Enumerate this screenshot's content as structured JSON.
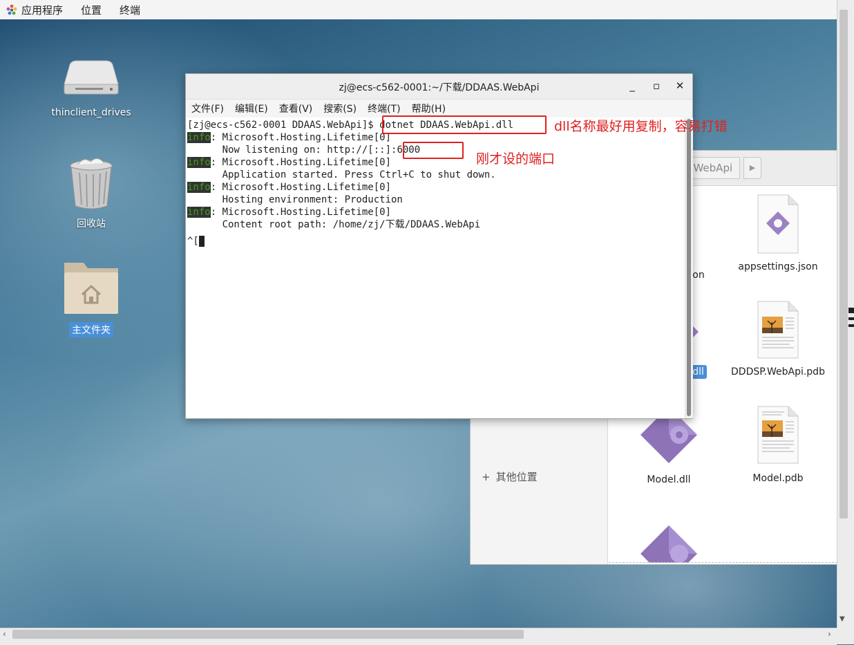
{
  "topbar": {
    "applications": "应用程序",
    "places": "位置",
    "terminal": "终端"
  },
  "desktop_icons": [
    {
      "label": "thinclient_drives"
    },
    {
      "label": "回收站"
    },
    {
      "label": "主文件夹"
    }
  ],
  "file_manager": {
    "breadcrumb": "P.WebApi",
    "sidebar_other": "其他位置",
    "partial_label_1": ".",
    "partial_label_2": "son",
    "files": [
      {
        "label": "appsettings.json"
      },
      {
        "label": "pi.dll"
      },
      {
        "label": "DDDSP.WebApi.pdb"
      },
      {
        "label": "Model.dll"
      },
      {
        "label": "Model.pdb"
      }
    ]
  },
  "terminal": {
    "title": "zj@ecs-c562-0001:~/下载/DDAAS.WebApi",
    "menu": [
      "文件(F)",
      "编辑(E)",
      "查看(V)",
      "搜索(S)",
      "终端(T)",
      "帮助(H)"
    ],
    "prompt": "[zj@ecs-c562-0001 DDAAS.WebApi]$ ",
    "command": "dotnet DDAAS.WebApi.dll",
    "info_tag": "info",
    "lines": [
      ": Microsoft.Hosting.Lifetime[0]",
      "      Now listening on: http://[::]:",
      ": Microsoft.Hosting.Lifetime[0]",
      "      Application started. Press Ctrl+C to shut down.",
      ": Microsoft.Hosting.Lifetime[0]",
      "      Hosting environment: Production",
      ": Microsoft.Hosting.Lifetime[0]",
      "      Content root path: /home/zj/下载/DDAAS.WebApi"
    ],
    "port": "6000",
    "last_line": "^["
  },
  "annotations": {
    "note1": "dll名称最好用复制，容易打错",
    "note2": "刚才设的端口",
    "color": "#e02020"
  }
}
